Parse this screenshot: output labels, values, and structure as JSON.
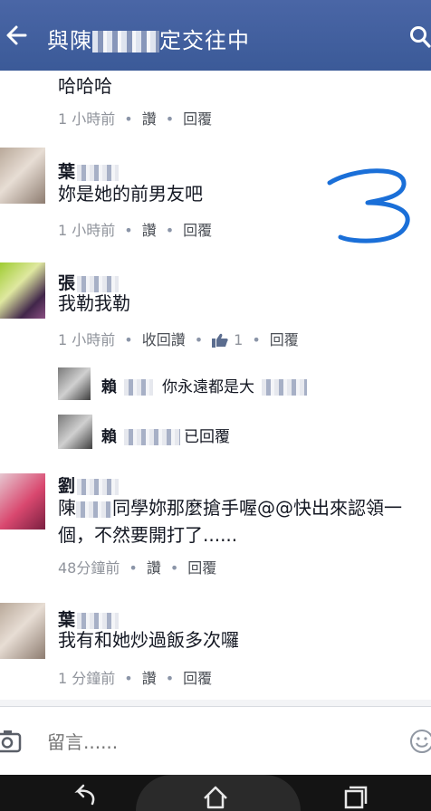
{
  "header": {
    "back_icon": "back-arrow-icon",
    "title_prefix": "與陳",
    "title_suffix": "定交往中",
    "search_icon": "search-icon",
    "background": "#3b5998"
  },
  "comments": [
    {
      "text": "哈哈哈",
      "time": "1 小時前",
      "like_label": "讚",
      "reply_label": "回覆"
    },
    {
      "name": "葉",
      "text": "妳是她的前男友吧",
      "time": "1 小時前",
      "like_label": "讚",
      "reply_label": "回覆"
    },
    {
      "name": "張",
      "text": "我勒我勒",
      "time": "1 小時前",
      "like_label": "收回讚",
      "like_count": "1",
      "reply_label": "回覆"
    },
    {
      "name": "劉",
      "text_line1": "陳",
      "text_line1_rest": "同學妳那麼搶手喔@@快出來認領一",
      "text_line2": "個，不然要開打了......",
      "time": "48分鐘前",
      "like_label": "讚",
      "reply_label": "回覆"
    },
    {
      "name": "葉",
      "text": "我有和她炒過飯多次囉",
      "time": "1 分鐘前",
      "like_label": "讚",
      "reply_label": "回覆"
    }
  ],
  "replies": [
    {
      "name": "賴",
      "text": "你永遠都是大"
    },
    {
      "name": "賴",
      "text": "已回覆"
    }
  ],
  "annotation": "3",
  "composer": {
    "camera_icon": "camera-icon",
    "placeholder": "留言......",
    "emoji_icon": "emoji-icon"
  },
  "navbar": {
    "back_icon": "nav-back-icon",
    "home_icon": "nav-home-icon",
    "recents_icon": "nav-recents-icon"
  },
  "colors": {
    "accent": "#3b5998",
    "annotation_ink": "#1a6fd8",
    "meta_text": "#90949c"
  }
}
